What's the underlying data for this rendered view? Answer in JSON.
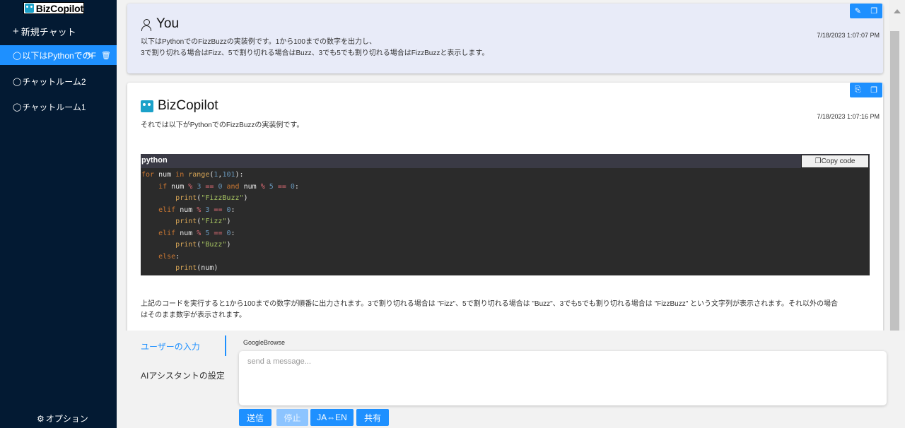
{
  "sidebar": {
    "logo_text": "BizCopilot",
    "new_chat": "新規チャット",
    "rooms": [
      {
        "label": "以下はPythonでのF",
        "active": true
      },
      {
        "label": "チャットルーム2",
        "active": false
      },
      {
        "label": "チャットルーム1",
        "active": false
      }
    ],
    "options": "オプション"
  },
  "messages": {
    "user": {
      "name": "You",
      "time": "7/18/2023 1:07:07 PM",
      "line1": "以下はPythonでのFizzBuzzの実装例です。1から100までの数字を出力し、",
      "line2": "3で割り切れる場合はFizz、5で割り切れる場合はBuzz、3でも5でも割り切れる場合はFizzBuzzと表示します。"
    },
    "bot": {
      "name": "BizCopilot",
      "time": "7/18/2023 1:07:16 PM",
      "intro": "それでは以下がPythonでのFizzBuzzの実装例です。",
      "code_lang": "python",
      "copy_label": "Copy code",
      "after_line1": "上記のコードを実行すると1から100までの数字が順番に出力されます。3で割り切れる場合は \"Fizz\"、5で割り切れる場合は \"Buzz\"、3でも5でも割り切れる場合は \"FizzBuzz\" という文字列が表示されます。それ以外の場合",
      "after_line2": "はそのまま数字が表示されます。"
    }
  },
  "input_area": {
    "tab_user": "ユーザーの入力",
    "tab_ai": "AIアシスタントの設定",
    "google_browse": "GoogleBrowse",
    "placeholder": "send a message...",
    "buttons": {
      "send": "送信",
      "stop": "停止",
      "translate": "JA⇔EN",
      "share": "共有"
    }
  }
}
